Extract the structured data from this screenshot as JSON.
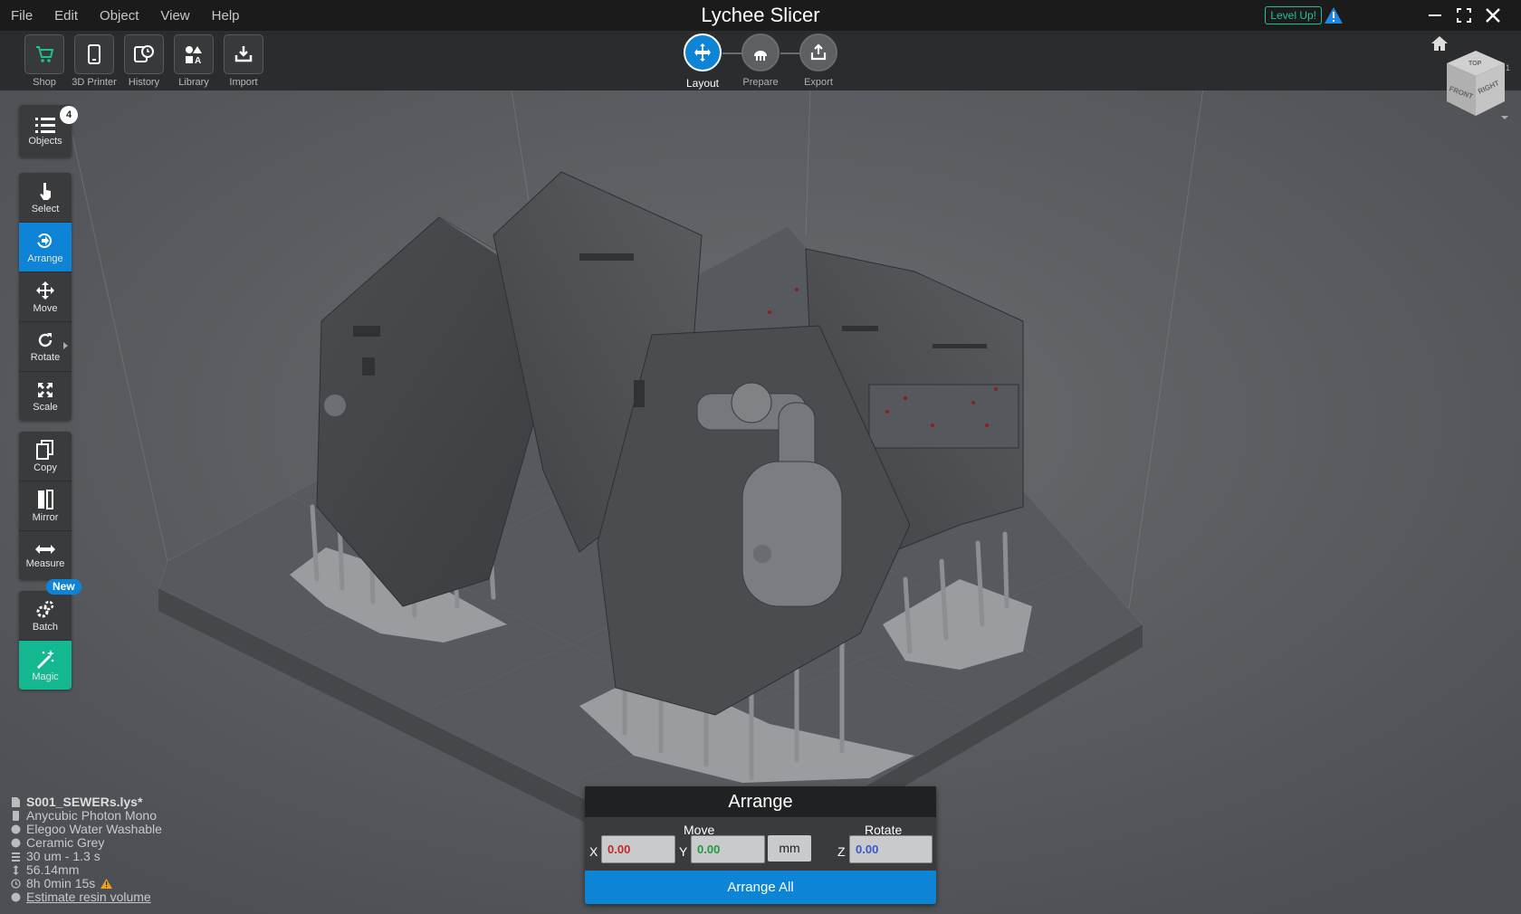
{
  "app": {
    "title": "Lychee Slicer",
    "version": "3.7.1",
    "level_up": "Level Up!"
  },
  "menu": [
    "File",
    "Edit",
    "Object",
    "View",
    "Help"
  ],
  "toolbar": [
    {
      "label": "Shop",
      "icon": "cart-icon"
    },
    {
      "label": "3D Printer",
      "icon": "printer-icon"
    },
    {
      "label": "History",
      "icon": "history-icon"
    },
    {
      "label": "Library",
      "icon": "library-icon"
    },
    {
      "label": "Import",
      "icon": "import-icon"
    }
  ],
  "steps": [
    {
      "label": "Layout",
      "active": true
    },
    {
      "label": "Prepare",
      "active": false
    },
    {
      "label": "Export",
      "active": false
    }
  ],
  "objects": {
    "label": "Objects",
    "count": "4"
  },
  "tools": [
    {
      "label": "Select",
      "icon": "pointer-icon"
    },
    {
      "label": "Arrange",
      "icon": "arrange-icon",
      "active": true
    },
    {
      "label": "Move",
      "icon": "move-icon"
    },
    {
      "label": "Rotate",
      "icon": "rotate-icon"
    },
    {
      "label": "Scale",
      "icon": "scale-icon"
    },
    {
      "label": "Copy",
      "icon": "copy-icon"
    },
    {
      "label": "Mirror",
      "icon": "mirror-icon"
    },
    {
      "label": "Measure",
      "icon": "measure-icon"
    },
    {
      "label": "Batch",
      "icon": "batch-icon",
      "badge": "New"
    },
    {
      "label": "Magic",
      "icon": "magic-icon"
    }
  ],
  "viewcube": {
    "top": "TOP",
    "front": "FRONT",
    "right": "RIGHT"
  },
  "info": {
    "filename": "S001_SEWERs.lys*",
    "printer": "Anycubic Photon Mono",
    "resin": "Elegoo Water Washable",
    "color": "Ceramic Grey",
    "layer": "30 um - 1.3 s",
    "height": "56.14mm",
    "time": "8h 0min 15s",
    "estimate_link": "Estimate resin volume"
  },
  "arrange_panel": {
    "title": "Arrange",
    "move_label": "Move",
    "rotate_label": "Rotate",
    "x_label": "X",
    "y_label": "Y",
    "z_label": "Z",
    "x_value": "0.00",
    "y_value": "0.00",
    "z_value": "0.00",
    "unit": "mm",
    "arrange_all": "Arrange All"
  },
  "colors": {
    "accent": "#0d84d6",
    "magic": "#14b890",
    "x_axis": "#c22a2a",
    "y_axis": "#1f9c3c",
    "z_axis": "#3c58c8"
  }
}
